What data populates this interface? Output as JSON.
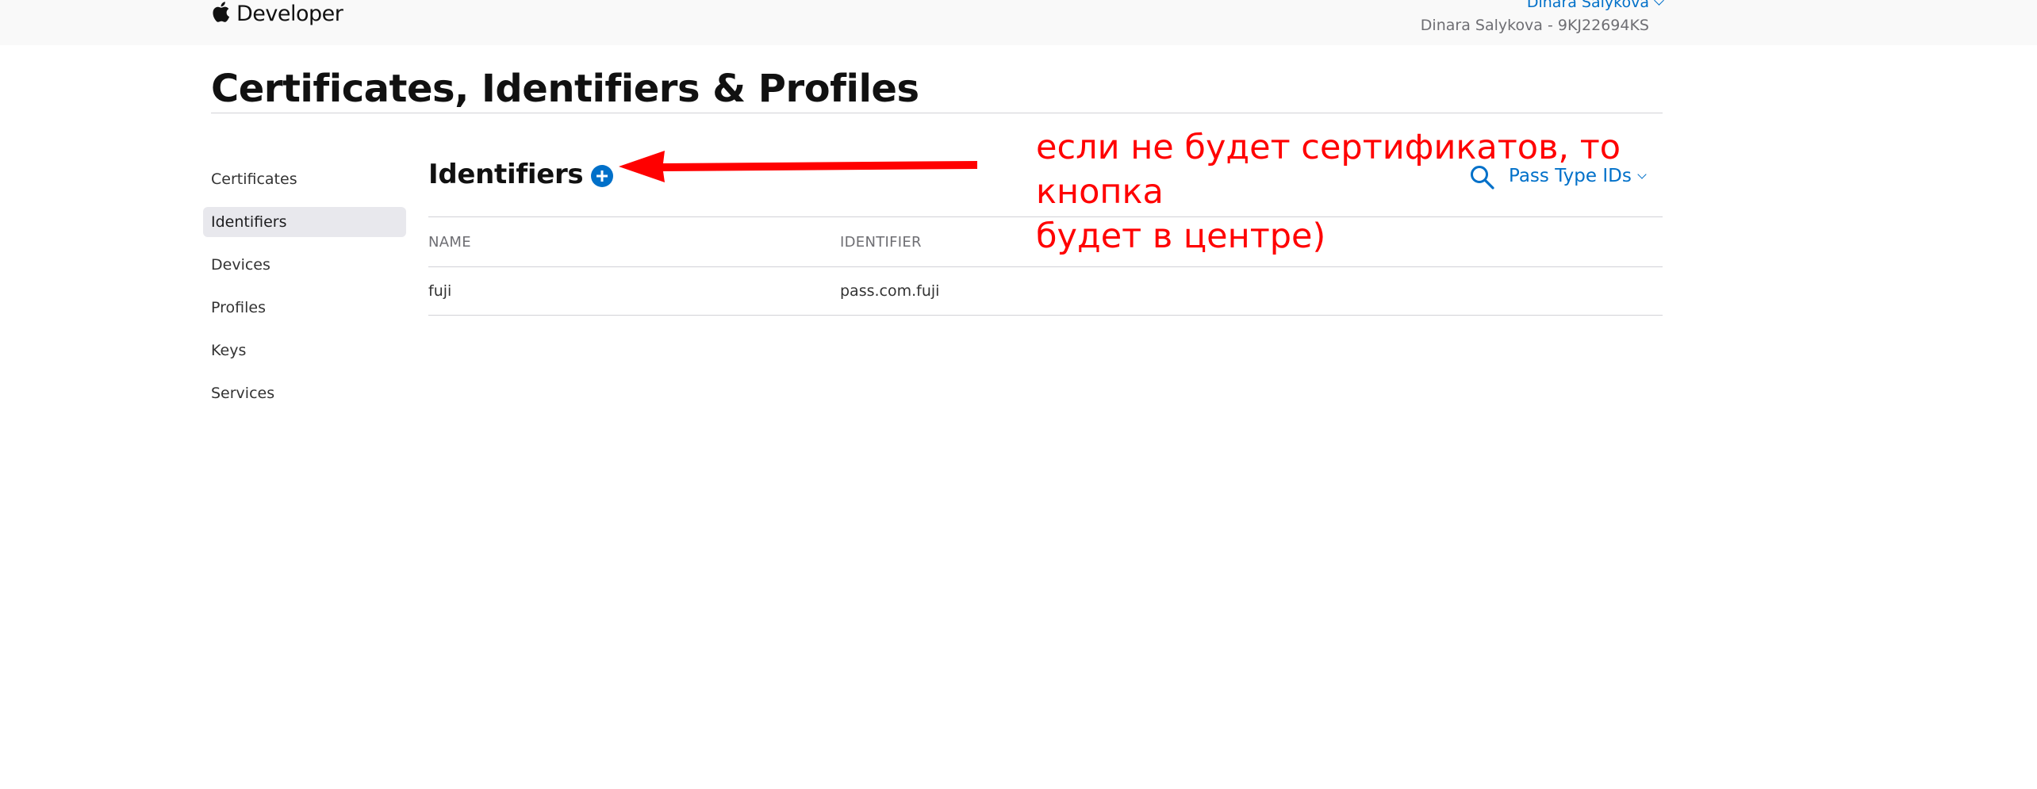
{
  "header": {
    "brand": "Developer",
    "account_name": "Dinara Salykova",
    "team_line": "Dinara Salykova - 9KJ22694KS"
  },
  "page": {
    "title": "Certificates, Identifiers & Profiles"
  },
  "sidebar": {
    "items": [
      {
        "label": "Certificates",
        "active": false
      },
      {
        "label": "Identifiers",
        "active": true
      },
      {
        "label": "Devices",
        "active": false
      },
      {
        "label": "Profiles",
        "active": false
      },
      {
        "label": "Keys",
        "active": false
      },
      {
        "label": "Services",
        "active": false
      }
    ]
  },
  "main": {
    "section_title": "Identifiers",
    "add_icon": "plus-circle-icon",
    "search_icon": "search-icon",
    "filter_value": "Pass Type IDs",
    "table": {
      "columns": [
        "NAME",
        "IDENTIFIER"
      ],
      "rows": [
        [
          "fuji",
          "pass.com.fuji"
        ]
      ]
    }
  },
  "annotation": {
    "text_line1": "если не будет сертификатов, то кнопка",
    "text_line2": "будет в центре)",
    "color": "#ff0000"
  },
  "colors": {
    "accent": "#0070c9",
    "header_bg": "#f9f9f9",
    "active_item_bg": "#e8e8ed",
    "divider": "#d2d2d7"
  }
}
